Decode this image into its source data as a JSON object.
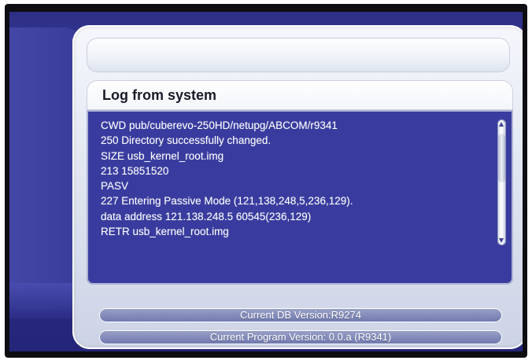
{
  "dialog": {
    "title": "Log from system",
    "log_lines": [
      "CWD pub/cuberevo-250HD/netupg/ABCOM/r9341",
      "250 Directory successfully changed.",
      "SIZE usb_kernel_root.img",
      "213 15851520",
      "PASV",
      "227 Entering Passive Mode (121,138,248,5,236,129).",
      "data address 121.138.248.5 60545(236,129)",
      "RETR usb_kernel_root.img"
    ]
  },
  "footer": {
    "db_version": "Current DB Version:R9274",
    "program_version": "Current Program Version: 0.0.a (R9341)"
  },
  "icons": {
    "scroll_up": "arrow-up-icon",
    "scroll_down": "arrow-down-icon"
  },
  "colors": {
    "log_background": "#393c9e",
    "screen_background": "#2e2f86",
    "panel": "#dfe4f0"
  }
}
